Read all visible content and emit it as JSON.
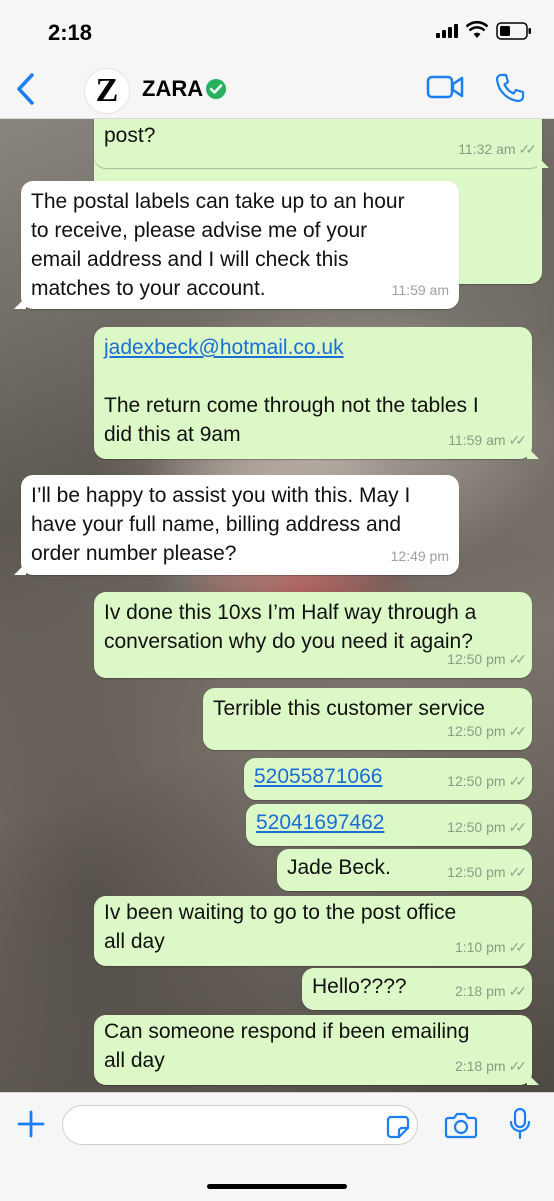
{
  "status_bar": {
    "time": "2:18"
  },
  "header": {
    "back_icon": "chevron-left-icon",
    "avatar_letter": "Z",
    "contact_name": "ZARA",
    "verified_icon": "verified-check-icon",
    "accent": "#1a7ff0"
  },
  "messages": [
    {
      "dir": "out",
      "text": "I still haven’t got them and I’m waiting to\npost?",
      "time": "11:32 am",
      "ticks": "✓✓"
    },
    {
      "dir": "in",
      "text": "The postal labels can take up to an hour\nto receive, please advise me of your\nemail address and I will check this\nmatches to your account.",
      "time": "11:59 am"
    },
    {
      "dir": "out",
      "link": "jadexbeck@hotmail.co.uk",
      "text": "\n\nThe return come through not the tables I\ndid this at 9am",
      "time": "11:59 am",
      "ticks": "✓✓"
    },
    {
      "dir": "in",
      "text": "I’ll be happy to assist you with this. May I\nhave your full name, billing address and\norder number please?",
      "time": "12:49 pm"
    },
    {
      "dir": "out",
      "text": "Iv done this 10xs I’m Half way through a\nconversation why do you need it again?",
      "time": "12:50 pm",
      "ticks": "✓✓"
    },
    {
      "dir": "out",
      "text": "Terrible this customer service",
      "time": "12:50 pm",
      "ticks": "✓✓"
    },
    {
      "dir": "out",
      "link": "52055871066",
      "time": "12:50 pm",
      "ticks": "✓✓"
    },
    {
      "dir": "out",
      "link": "52041697462",
      "time": "12:50 pm",
      "ticks": "✓✓"
    },
    {
      "dir": "out",
      "text": "Jade Beck.",
      "time": "12:50 pm",
      "ticks": "✓✓"
    },
    {
      "dir": "out",
      "text": "Iv been waiting to go to the post office\nall day",
      "time": "1:10 pm",
      "ticks": "✓✓"
    },
    {
      "dir": "out",
      "text": "Hello????",
      "time": "2:18 pm",
      "ticks": "✓✓"
    },
    {
      "dir": "out",
      "text": "Can someone respond if been emailing\nall day",
      "time": "2:18 pm",
      "ticks": "✓✓"
    }
  ],
  "colors": {
    "outgoing_bubble": "#dcf8c6",
    "incoming_bubble": "#ffffff",
    "link": "#1a6fd6"
  }
}
